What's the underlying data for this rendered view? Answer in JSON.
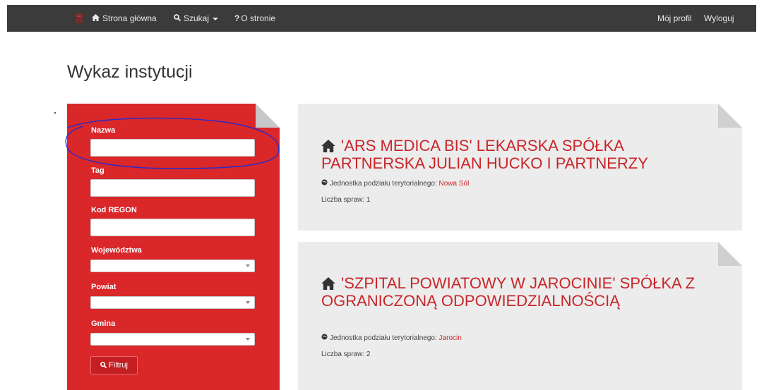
{
  "nav": {
    "home": "Strona główna",
    "search": "Szukaj",
    "about": "O stronie",
    "profile": "Mój profil",
    "logout": "Wyloguj"
  },
  "page_title": "Wykaz instytucji",
  "filters": {
    "name_label": "Nazwa",
    "tag_label": "Tag",
    "regon_label": "Kod REGON",
    "voivodeship_label": "Województwa",
    "county_label": "Powiat",
    "commune_label": "Gmina",
    "button_label": "Filtruj"
  },
  "institutions": [
    {
      "title": "'ARS MEDICA BIS' LEKARSKA SPÓŁKA PARTNERSKA JULIAN HUCKO I PARTNERZY",
      "unit_label": "Jednostka podziału terytorialnego:",
      "unit_value": "Nowa Sól",
      "cases_label": "Liczba spraw:",
      "cases_value": "1"
    },
    {
      "title": "'SZPITAL POWIATOWY W JAROCINIE' SPÓŁKA Z OGRANICZONĄ ODPOWIEDZIALNOŚCIĄ",
      "unit_label": "Jednostka podziału terytorialnego:",
      "unit_value": "Jarocin",
      "cases_label": "Liczba spraw:",
      "cases_value": "2"
    }
  ],
  "colors": {
    "navbar": "#3b3b3b",
    "accent": "#d9272a",
    "card_bg": "#ececec",
    "annotation": "#2a2acb"
  },
  "icons": [
    "logo-icon",
    "home-icon",
    "search-icon",
    "question-icon",
    "globe-icon"
  ]
}
